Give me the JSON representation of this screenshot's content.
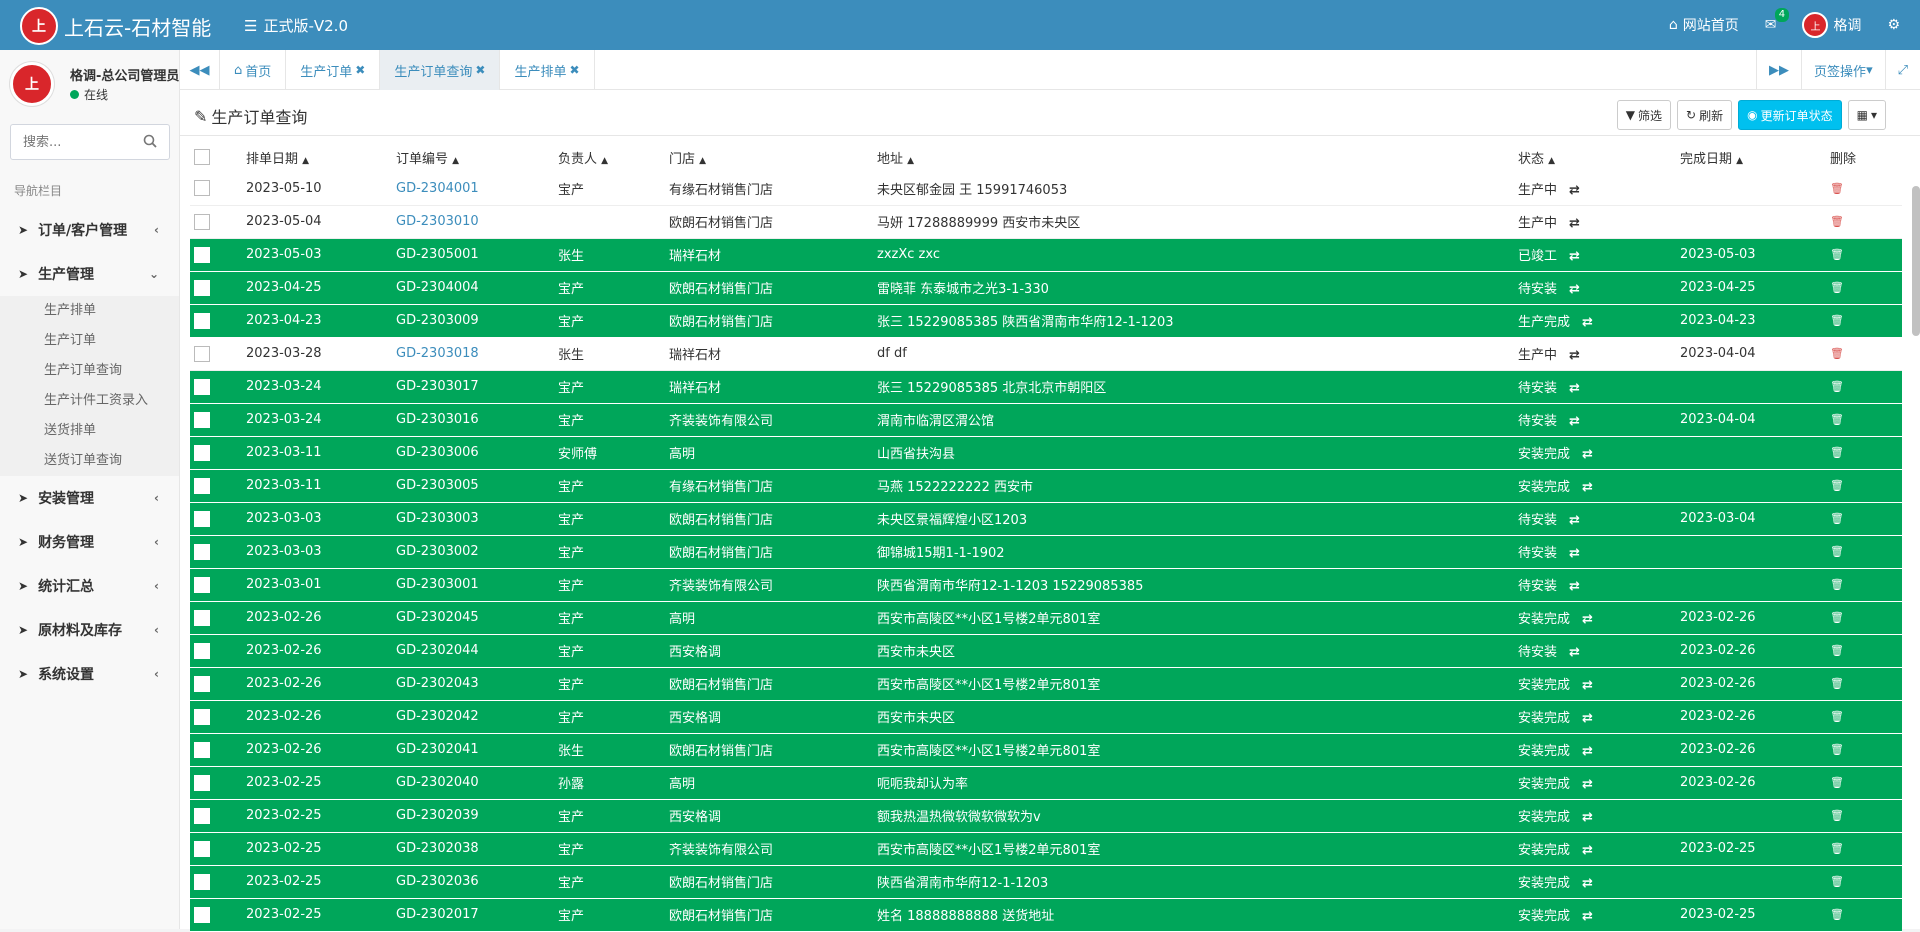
{
  "header": {
    "logo_text": "上石云-石材智能",
    "version": "正式版-V2.0",
    "site_home": "网站首页",
    "mail_count": "4",
    "user": "格调"
  },
  "sidebar": {
    "user_name": "格调-总公司管理员",
    "status": "在线",
    "search_placeholder": "搜索...",
    "nav_header": "导航栏目",
    "menu": [
      {
        "label": "订单/客户管理"
      },
      {
        "label": "生产管理"
      },
      {
        "label": "安装管理"
      },
      {
        "label": "财务管理"
      },
      {
        "label": "统计汇总"
      },
      {
        "label": "原材料及库存"
      },
      {
        "label": "系统设置"
      }
    ],
    "sub_items": [
      "生产排单",
      "生产订单",
      "生产订单查询",
      "生产计件工资录入",
      "送货排单",
      "送货订单查询"
    ]
  },
  "tabs": {
    "items": [
      "首页",
      "生产订单",
      "生产订单查询",
      "生产排单"
    ],
    "page_ops": "页签操作"
  },
  "page": {
    "title": "生产订单查询",
    "filter": "筛选",
    "refresh": "刷新",
    "update_status": "更新订单状态"
  },
  "table": {
    "headers": [
      "排单日期",
      "订单编号",
      "负责人",
      "门店",
      "地址",
      "状态",
      "完成日期",
      "删除"
    ],
    "rows": [
      {
        "date": "2023-05-10",
        "no": "GD-2304001",
        "owner": "宝产",
        "store": "有缘石材销售门店",
        "addr": "未央区郁金园 王 15991746053",
        "status": "生产中",
        "done": "",
        "green": false
      },
      {
        "date": "2023-05-04",
        "no": "GD-2303010",
        "owner": "",
        "store": "欧朗石材销售门店",
        "addr": "马妍 17288889999 西安市未央区",
        "status": "生产中",
        "done": "",
        "green": false
      },
      {
        "date": "2023-05-03",
        "no": "GD-2305001",
        "owner": "张生",
        "store": "瑞祥石材",
        "addr": "zxzXc zxc",
        "status": "已竣工",
        "done": "2023-05-03",
        "green": true
      },
      {
        "date": "2023-04-25",
        "no": "GD-2304004",
        "owner": "宝产",
        "store": "欧朗石材销售门店",
        "addr": "雷晓菲 东泰城市之光3-1-330",
        "status": "待安装",
        "done": "2023-04-25",
        "green": true
      },
      {
        "date": "2023-04-23",
        "no": "GD-2303009",
        "owner": "宝产",
        "store": "欧朗石材销售门店",
        "addr": "张三 15229085385 陕西省渭南市华府12-1-1203",
        "status": "生产完成",
        "done": "2023-04-23",
        "green": true
      },
      {
        "date": "2023-03-28",
        "no": "GD-2303018",
        "owner": "张生",
        "store": "瑞祥石材",
        "addr": "df df",
        "status": "生产中",
        "done": "2023-04-04",
        "green": false
      },
      {
        "date": "2023-03-24",
        "no": "GD-2303017",
        "owner": "宝产",
        "store": "瑞祥石材",
        "addr": "张三 15229085385 北京北京市朝阳区",
        "status": "待安装",
        "done": "",
        "green": true
      },
      {
        "date": "2023-03-24",
        "no": "GD-2303016",
        "owner": "宝产",
        "store": "齐装装饰有限公司",
        "addr": "渭南市临渭区渭公馆",
        "status": "待安装",
        "done": "2023-04-04",
        "green": true
      },
      {
        "date": "2023-03-11",
        "no": "GD-2303006",
        "owner": "安师傅",
        "store": "高明",
        "addr": "山西省扶沟县",
        "status": "安装完成",
        "done": "",
        "green": true
      },
      {
        "date": "2023-03-11",
        "no": "GD-2303005",
        "owner": "宝产",
        "store": "有缘石材销售门店",
        "addr": "马燕 1522222222 西安市",
        "status": "安装完成",
        "done": "",
        "green": true
      },
      {
        "date": "2023-03-03",
        "no": "GD-2303003",
        "owner": "宝产",
        "store": "欧朗石材销售门店",
        "addr": "未央区景福辉煌小区1203",
        "status": "待安装",
        "done": "2023-03-04",
        "green": true
      },
      {
        "date": "2023-03-03",
        "no": "GD-2303002",
        "owner": "宝产",
        "store": "欧朗石材销售门店",
        "addr": "御锦城15期1-1-1902",
        "status": "待安装",
        "done": "",
        "green": true
      },
      {
        "date": "2023-03-01",
        "no": "GD-2303001",
        "owner": "宝产",
        "store": "齐装装饰有限公司",
        "addr": "陕西省渭南市华府12-1-1203 15229085385",
        "status": "待安装",
        "done": "",
        "green": true
      },
      {
        "date": "2023-02-26",
        "no": "GD-2302045",
        "owner": "宝产",
        "store": "高明",
        "addr": "西安市高陵区**小区1号楼2单元801室",
        "status": "安装完成",
        "done": "2023-02-26",
        "green": true
      },
      {
        "date": "2023-02-26",
        "no": "GD-2302044",
        "owner": "宝产",
        "store": "西安格调",
        "addr": "西安市未央区",
        "status": "待安装",
        "done": "2023-02-26",
        "green": true
      },
      {
        "date": "2023-02-26",
        "no": "GD-2302043",
        "owner": "宝产",
        "store": "欧朗石材销售门店",
        "addr": "西安市高陵区**小区1号楼2单元801室",
        "status": "安装完成",
        "done": "2023-02-26",
        "green": true
      },
      {
        "date": "2023-02-26",
        "no": "GD-2302042",
        "owner": "宝产",
        "store": "西安格调",
        "addr": "西安市未央区",
        "status": "安装完成",
        "done": "2023-02-26",
        "green": true
      },
      {
        "date": "2023-02-26",
        "no": "GD-2302041",
        "owner": "张生",
        "store": "欧朗石材销售门店",
        "addr": "西安市高陵区**小区1号楼2单元801室",
        "status": "安装完成",
        "done": "2023-02-26",
        "green": true
      },
      {
        "date": "2023-02-25",
        "no": "GD-2302040",
        "owner": "孙露",
        "store": "高明",
        "addr": "呃呃我却认为率",
        "status": "安装完成",
        "done": "2023-02-26",
        "green": true
      },
      {
        "date": "2023-02-25",
        "no": "GD-2302039",
        "owner": "宝产",
        "store": "西安格调",
        "addr": "额我热温热微软微软微软为v",
        "status": "安装完成",
        "done": "",
        "green": true
      },
      {
        "date": "2023-02-25",
        "no": "GD-2302038",
        "owner": "宝产",
        "store": "齐装装饰有限公司",
        "addr": "西安市高陵区**小区1号楼2单元801室",
        "status": "安装完成",
        "done": "2023-02-25",
        "green": true
      },
      {
        "date": "2023-02-25",
        "no": "GD-2302036",
        "owner": "宝产",
        "store": "欧朗石材销售门店",
        "addr": "陕西省渭南市华府12-1-1203",
        "status": "安装完成",
        "done": "",
        "green": true
      },
      {
        "date": "2023-02-25",
        "no": "GD-2302017",
        "owner": "宝产",
        "store": "欧朗石材销售门店",
        "addr": "姓名 18888888888 送货地址",
        "status": "安装完成",
        "done": "2023-02-25",
        "green": true
      }
    ]
  }
}
